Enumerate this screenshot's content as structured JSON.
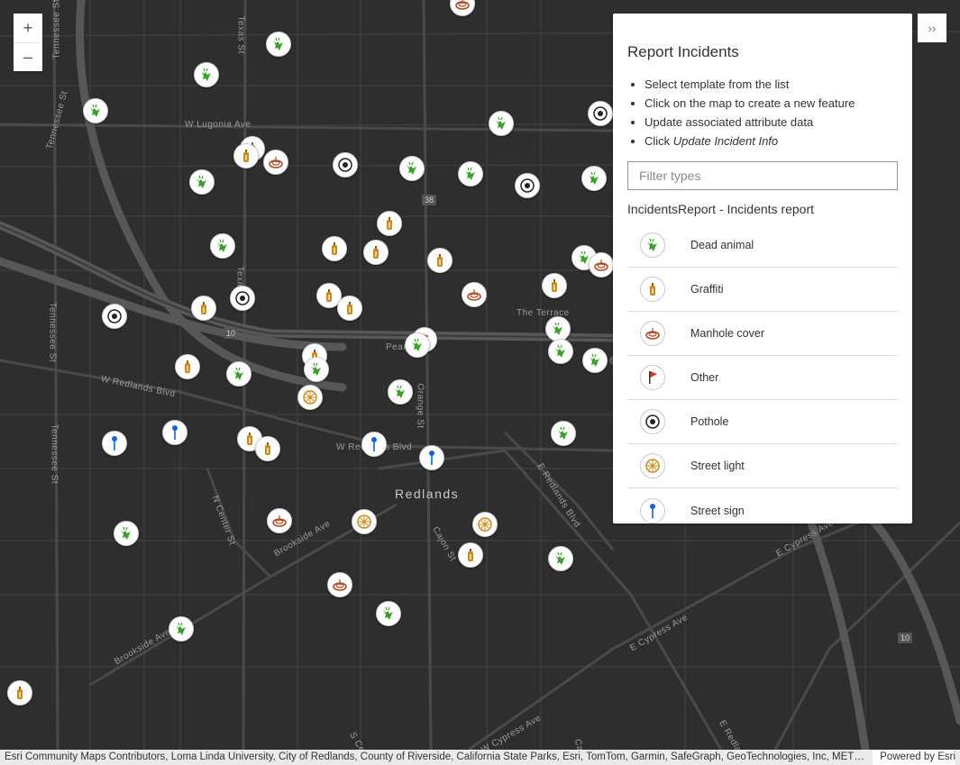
{
  "map": {
    "city_label": "Redlands",
    "street_labels": {
      "tennessee_1": "Tennessee St",
      "tennessee_2": "Tennessee St",
      "tennessee_3": "Tennessee St",
      "tennessee_4": "Tennessee St",
      "texas_1": "Texas St",
      "texas_2": "Texas St",
      "lugonia": "W Lugonia Ave",
      "redlands_blvd_w": "W Redlands Blvd",
      "redlands_blvd_c": "W Redlands Blvd",
      "e_redlands_blvd": "E Redlands Blvd",
      "pearl": "Pearl Ave",
      "orange": "Orange St",
      "terrace": "The Terrace",
      "n_center": "N Center St",
      "brookside_1": "Brookside Ave",
      "brookside_2": "Brookside Ave",
      "cajon_1": "Cajon St",
      "cajon_2": "Cajon",
      "e_cypress_1": "E Cypress Ave",
      "e_cypress_2": "E Cypress Ave",
      "w_cypress": "W Cypress Ave",
      "s_center": "S Cen",
      "e_redlan": "E Redlan"
    },
    "shields": {
      "hwy38": "38",
      "i10_a": "10",
      "i10_b": "10"
    }
  },
  "zoom": {
    "in_label": "+",
    "out_label": "–"
  },
  "collapse": {
    "label": "››"
  },
  "panel": {
    "title": "Report Incidents",
    "steps": [
      "Select template from the list",
      "Click on the map to create a new feature",
      "Update associated attribute data"
    ],
    "step4_prefix": "Click ",
    "step4_emphasis": "Update Incident Info",
    "filter_placeholder": "Filter types",
    "layer_name": "IncidentsReport - Incidents report",
    "templates": [
      {
        "label": "Dead animal",
        "icon": "dead-animal-icon"
      },
      {
        "label": "Graffiti",
        "icon": "graffiti-icon"
      },
      {
        "label": "Manhole cover",
        "icon": "manhole-icon"
      },
      {
        "label": "Other",
        "icon": "flag-icon"
      },
      {
        "label": "Pothole",
        "icon": "pothole-icon"
      },
      {
        "label": "Street light",
        "icon": "street-light-icon"
      },
      {
        "label": "Street sign",
        "icon": "street-sign-icon"
      }
    ]
  },
  "attribution": {
    "credits": "Esri Community Maps Contributors, Loma Linda University, City of Redlands, County of Riverside, California State Parks, Esri, TomTom, Garmin, SafeGraph, GeoTechnologies, Inc, METI/NASA, USGS, Bureau of Land Management, EPA, NPS, US Census Bureau, USDA, USFWS",
    "powered_by": "Powered by Esri"
  },
  "colors": {
    "map_bg": "#2e2e2e",
    "road": "#4a4a4a",
    "freeway": "#565656",
    "green": "#3ba12a",
    "orange": "#c98b1a",
    "blue": "#1565d8",
    "red": "#d73a1d"
  }
}
